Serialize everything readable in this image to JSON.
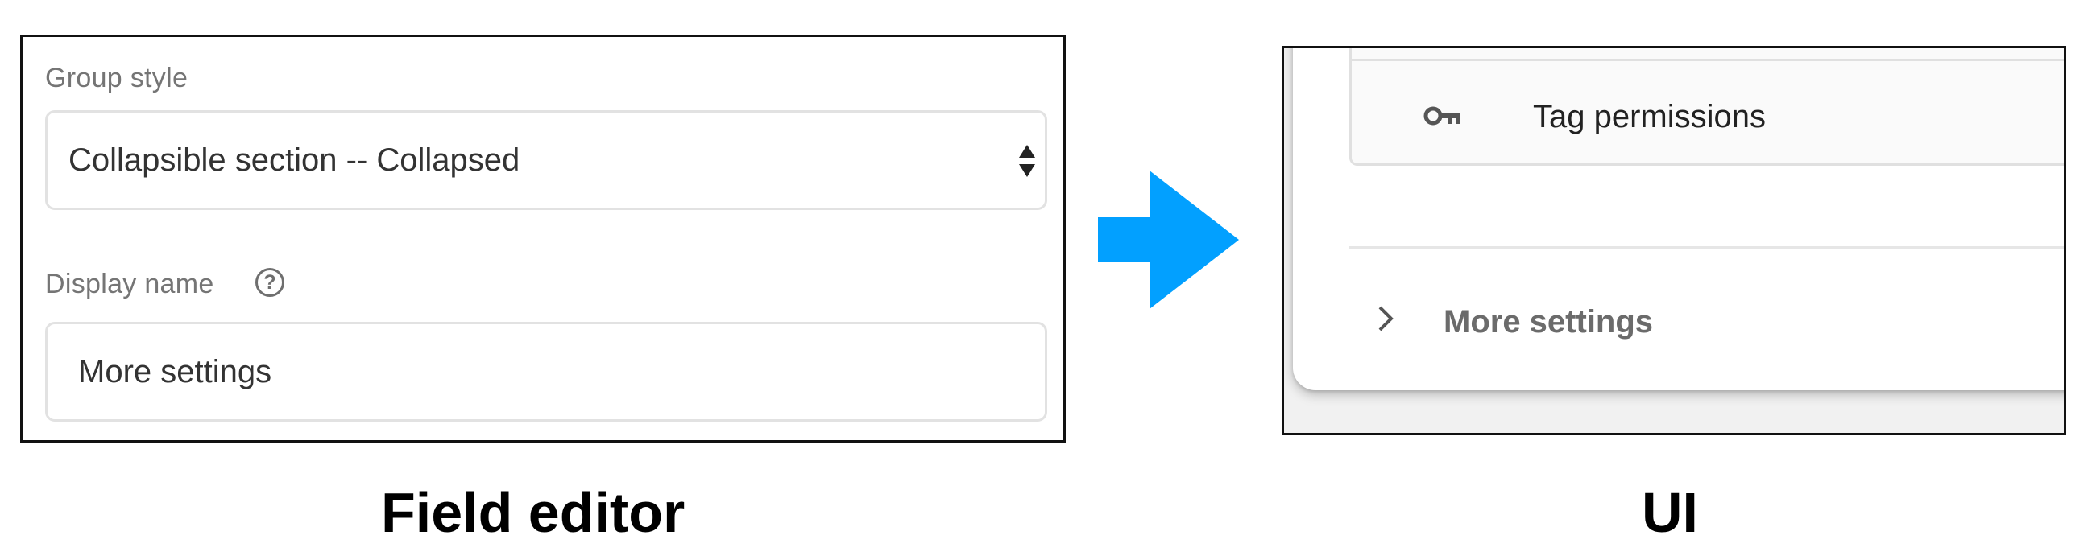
{
  "field_editor": {
    "group_style_label": "Group style",
    "group_style_value": "Collapsible section -- Collapsed",
    "display_name_label": "Display name",
    "help_icon_glyph": "?",
    "display_name_value": "More settings",
    "caption": "Field editor"
  },
  "ui_preview": {
    "permission_item_label": "Tag permissions",
    "permission_item_icon": "key-icon",
    "more_settings_label": "More settings",
    "more_settings_icon": "chevron-right-icon",
    "caption": "UI"
  },
  "arrow": {
    "icon": "arrow-right-icon",
    "color": "#02A0FF"
  }
}
